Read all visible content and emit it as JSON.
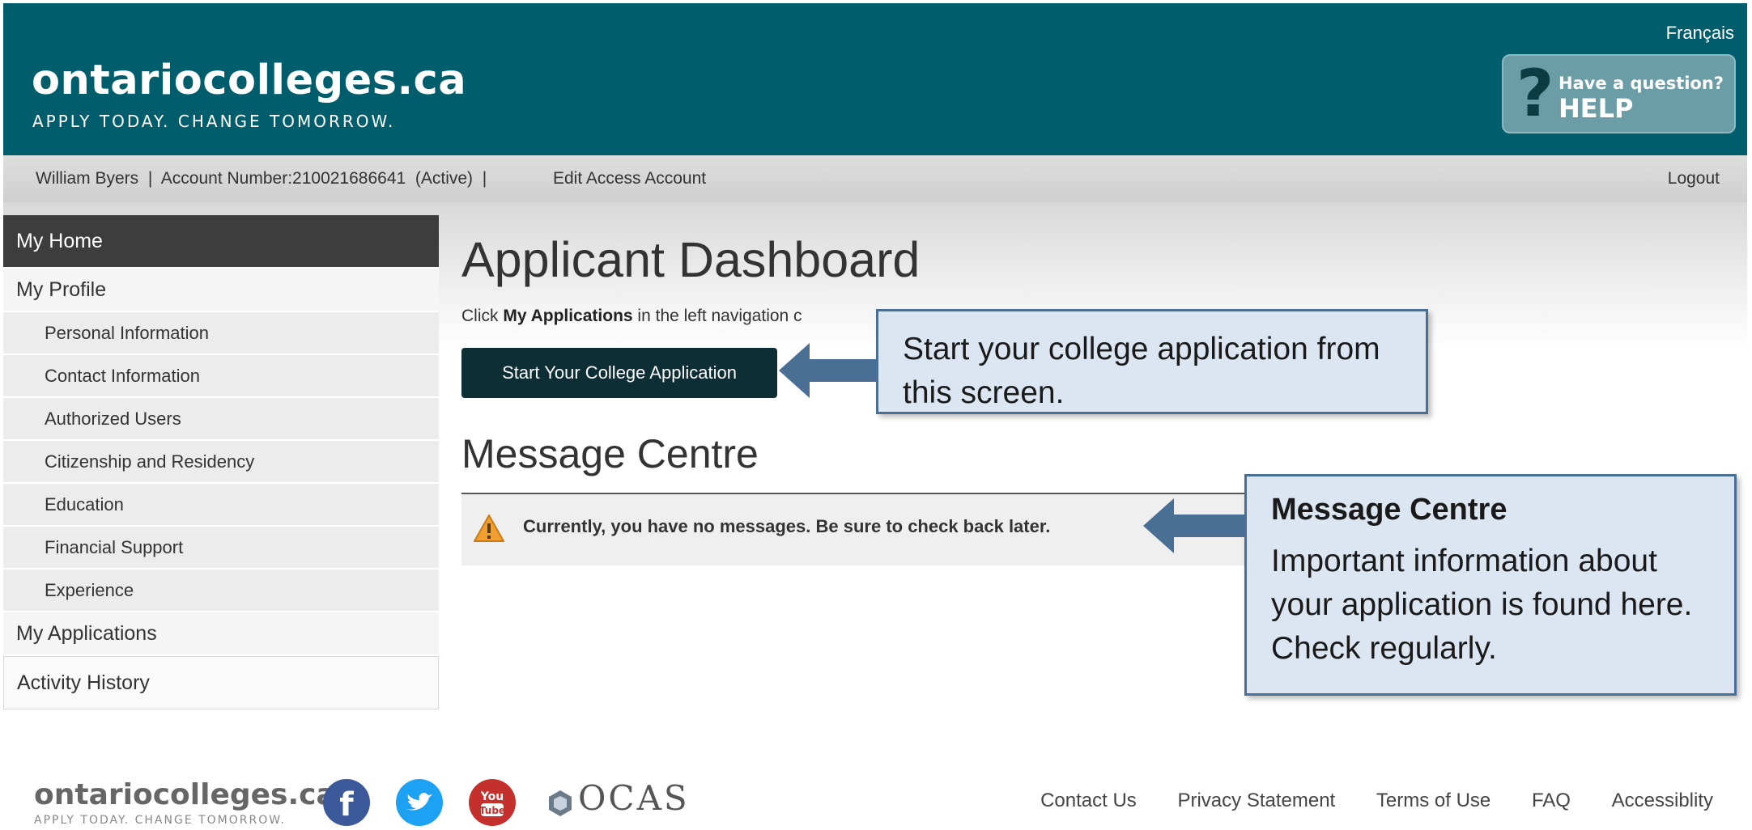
{
  "header": {
    "brand_name": "ontariocolleges.ca",
    "brand_tagline": "APPLY TODAY. CHANGE TOMORROW.",
    "language_link": "Français",
    "help": {
      "question": "Have a question?",
      "label": "HELP",
      "icon": "question-mark-icon"
    }
  },
  "account_bar": {
    "info": "William Byers  |  Account Number:210021686641  (Active)  |",
    "edit_link": "Edit Access Account",
    "logout": "Logout"
  },
  "sidebar": {
    "items": [
      {
        "label": "My Home",
        "active": true
      },
      {
        "label": "My Profile"
      },
      {
        "label": "Personal Information",
        "sub": true
      },
      {
        "label": "Contact Information",
        "sub": true
      },
      {
        "label": "Authorized Users",
        "sub": true
      },
      {
        "label": "Citizenship and Residency",
        "sub": true
      },
      {
        "label": "Education",
        "sub": true
      },
      {
        "label": "Financial Support",
        "sub": true
      },
      {
        "label": "Experience",
        "sub": true
      },
      {
        "label": "My Applications"
      },
      {
        "label": "Activity History"
      }
    ]
  },
  "main": {
    "title": "Applicant Dashboard",
    "intro_prefix": "Click ",
    "intro_bold": "My Applications",
    "intro_suffix": " in the left navigation c",
    "start_button": "Start Your College Application",
    "message_section_title": "Message Centre",
    "message_text": "Currently, you have no messages. Be sure to check back later.",
    "message_icon": "warning-icon"
  },
  "callouts": {
    "start": {
      "text": "Start your college application from this screen."
    },
    "messages": {
      "heading": "Message Centre",
      "text": "Important information about your application is found here. Check regularly."
    }
  },
  "footer": {
    "brand_name": "ontariocolleges.ca",
    "brand_tagline": "APPLY TODAY. CHANGE TOMORROW.",
    "social": [
      {
        "name": "facebook-icon",
        "glyph": "f",
        "color": "#3b5998"
      },
      {
        "name": "twitter-icon",
        "glyph": "t",
        "color": "#1da1f2"
      },
      {
        "name": "youtube-icon",
        "glyph": "You Tube",
        "color": "#c4302b"
      }
    ],
    "ocas": "OCAS",
    "links": [
      "Contact Us",
      "Privacy Statement",
      "Terms of Use",
      "FAQ",
      "Accessiblity"
    ]
  },
  "colors": {
    "header_bg": "#005d6c",
    "callout_bg": "#dbe6f2",
    "callout_border": "#4a6f95",
    "start_button_bg": "#0e2e35"
  }
}
